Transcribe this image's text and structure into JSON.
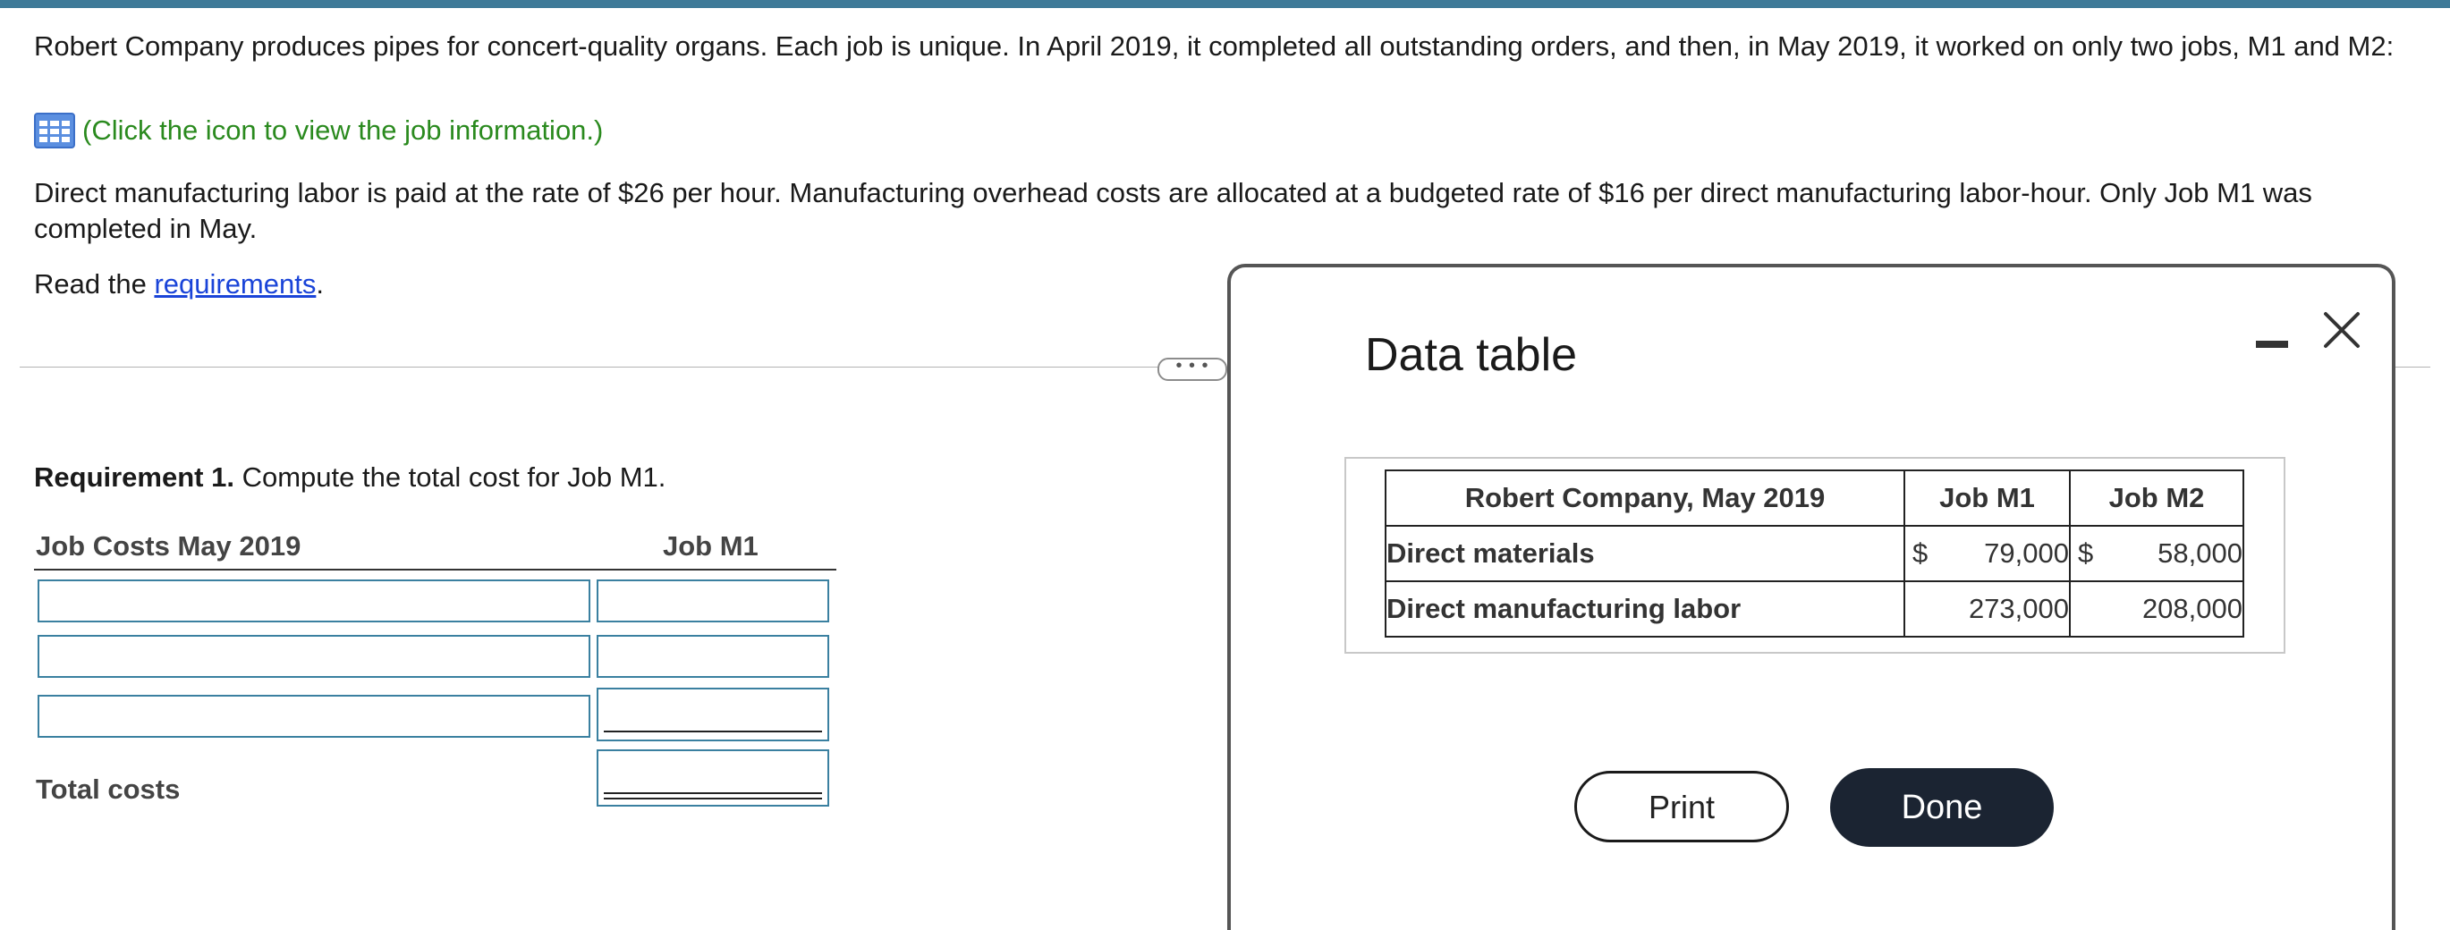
{
  "colors": {
    "top_bar": "#3e7a98",
    "link_green": "#2a8a1e",
    "link_blue": "#1a44d8",
    "input_border": "#3a80a0",
    "done_button": "#1b2432"
  },
  "problem": {
    "intro": "Robert Company produces pipes for concert-quality organs. Each job is unique. In April 2019, it completed all outstanding orders, and then, in May 2019, it worked on only two jobs, M1 and M2:",
    "icon_name": "data-table-icon",
    "icon_link": "(Click the icon to view the job information.)",
    "direct_labor": "Direct manufacturing labor is paid at the rate of $26 per hour. Manufacturing overhead costs are allocated at a budgeted rate of $16 per direct manufacturing labor-hour. Only Job M1 was completed in May.",
    "read_prefix": "Read the ",
    "read_link": "requirements",
    "read_suffix": ".",
    "dots": "• • •"
  },
  "requirement": {
    "number": "Requirement 1.",
    "text": " Compute the total cost for Job M1.",
    "col1_header": "Job Costs May 2019",
    "col2_header": "Job M1",
    "rows": [
      {
        "label_value": "",
        "amount_value": ""
      },
      {
        "label_value": "",
        "amount_value": ""
      },
      {
        "label_value": "",
        "amount_value": ""
      }
    ],
    "total_label": "Total costs",
    "total_value": ""
  },
  "modal": {
    "title": "Data table",
    "table": {
      "headers": [
        "Robert Company, May 2019",
        "Job M1",
        "Job M2"
      ],
      "rows": [
        {
          "label": "Direct materials",
          "m1_currency": "$",
          "m1": "79,000",
          "m2_currency": "$",
          "m2": "58,000"
        },
        {
          "label": "Direct manufacturing labor",
          "m1_currency": "",
          "m1": "273,000",
          "m2_currency": "",
          "m2": "208,000"
        }
      ]
    },
    "print_label": "Print",
    "done_label": "Done"
  }
}
